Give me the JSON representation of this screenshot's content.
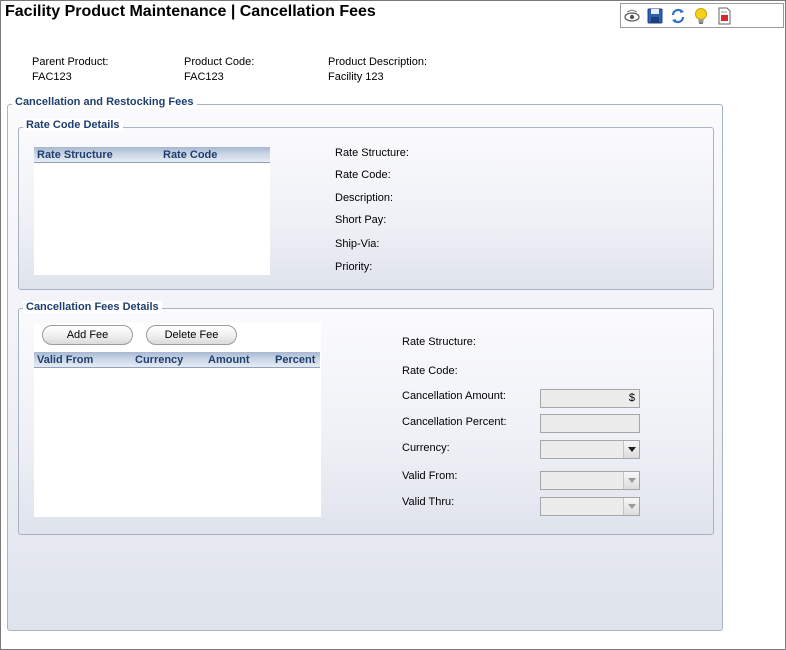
{
  "page": {
    "title": "Facility Product Maintenance  |  Cancellation Fees"
  },
  "toolbar": {
    "icons": [
      "view-icon",
      "save-icon",
      "refresh-icon",
      "help-icon",
      "report-icon"
    ]
  },
  "header": {
    "parent_product_label": "Parent Product:",
    "parent_product_value": "FAC123",
    "product_code_label": "Product Code:",
    "product_code_value": "FAC123",
    "product_description_label": "Product Description:",
    "product_description_value": "Facility 123"
  },
  "outer_group": {
    "legend": "Cancellation and Restocking Fees"
  },
  "rate_code_details": {
    "legend": "Rate Code Details",
    "columns": [
      "Rate Structure",
      "Rate Code"
    ],
    "rows": [],
    "fields": {
      "rate_structure": "Rate Structure:",
      "rate_code": "Rate Code:",
      "description": "Description:",
      "short_pay": "Short Pay:",
      "ship_via": "Ship-Via:",
      "priority": "Priority:"
    }
  },
  "cancellation_fees_details": {
    "legend": "Cancellation Fees Details",
    "add_fee_label": "Add Fee",
    "delete_fee_label": "Delete Fee",
    "columns": [
      "Valid From",
      "Currency",
      "Amount",
      "Percent"
    ],
    "rows": [],
    "fields": {
      "rate_structure": "Rate Structure:",
      "rate_code": "Rate Code:",
      "cancellation_amount": "Cancellation Amount:",
      "cancellation_amount_suffix": "$",
      "cancellation_percent": "Cancellation Percent:",
      "currency": "Currency:",
      "valid_from": "Valid From:",
      "valid_thru": "Valid Thru:"
    },
    "values": {
      "cancellation_amount": "",
      "cancellation_percent": "",
      "currency": "",
      "valid_from": "",
      "valid_thru": ""
    }
  },
  "colors": {
    "legend_text": "#1f3f6e",
    "group_border": "#a9b3c2",
    "grid_header_top": "#a7b8d2"
  }
}
